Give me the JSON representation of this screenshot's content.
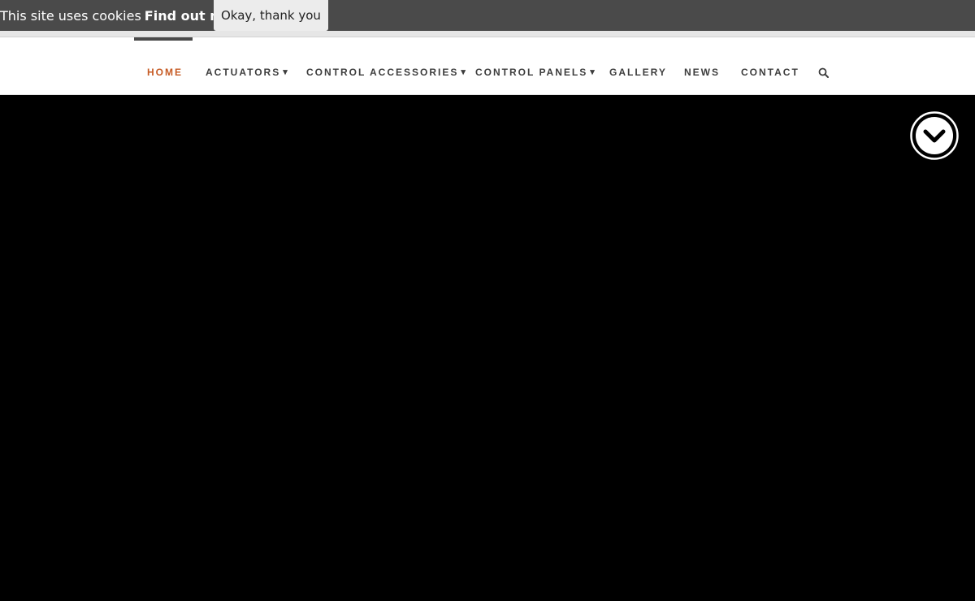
{
  "cookie_bar": {
    "message": "This site uses cookies",
    "link_label": "Find out more.",
    "accept_label": "Okay, thank you"
  },
  "nav": {
    "items": [
      {
        "label": "HOME",
        "active": true,
        "dropdown": false
      },
      {
        "label": "ACTUATORS",
        "active": false,
        "dropdown": true
      },
      {
        "label": "CONTROL ACCESSORIES",
        "active": false,
        "dropdown": true
      },
      {
        "label": "CONTROL PANELS",
        "active": false,
        "dropdown": true
      },
      {
        "label": "GALLERY",
        "active": false,
        "dropdown": false
      },
      {
        "label": "NEWS",
        "active": false,
        "dropdown": false
      },
      {
        "label": "CONTACT",
        "active": false,
        "dropdown": false
      }
    ],
    "dropdown_glyph": "»",
    "search_icon": "search-icon",
    "accent_color": "#c65a23"
  },
  "hero": {
    "background": "#000000",
    "scroll_icon": "chevron-down-circle-icon"
  }
}
